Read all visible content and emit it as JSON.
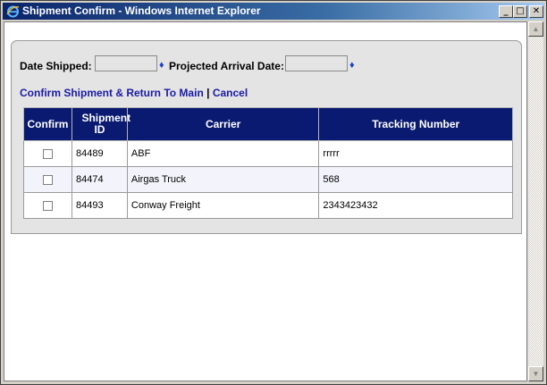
{
  "window": {
    "title": "Shipment Confirm - Windows Internet Explorer"
  },
  "form": {
    "date_shipped_label": "Date Shipped:",
    "date_shipped_value": "",
    "projected_arrival_label": "Projected Arrival Date:",
    "projected_arrival_value": "",
    "required_marker": "♦"
  },
  "actions": {
    "confirm_label": "Confirm Shipment & Return To Main",
    "separator": "|",
    "cancel_label": "Cancel"
  },
  "table": {
    "headers": {
      "confirm": "Confirm",
      "shipment_id": "Shipment ID",
      "carrier": "Carrier",
      "tracking": "Tracking Number"
    },
    "rows": [
      {
        "confirmed": false,
        "shipment_id": "84489",
        "carrier": "ABF",
        "tracking": "rrrrr"
      },
      {
        "confirmed": false,
        "shipment_id": "84474",
        "carrier": "Airgas Truck",
        "tracking": "568"
      },
      {
        "confirmed": false,
        "shipment_id": "84493",
        "carrier": "Conway Freight",
        "tracking": "2343423432"
      }
    ]
  },
  "icons": {
    "browser": "ie-logo-icon",
    "minimize": "minimize-icon",
    "maximize": "maximize-icon",
    "close": "close-icon",
    "scroll_up": "scroll-up-arrow-icon",
    "scroll_down": "scroll-down-arrow-icon"
  },
  "colors": {
    "title_bar": "#0a246a",
    "table_header": "#0a1a70",
    "link": "#1a1aa6",
    "required_marker": "#1e3fd0"
  }
}
